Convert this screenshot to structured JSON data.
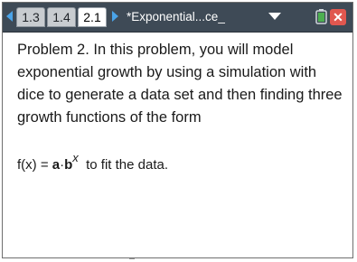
{
  "tabs": [
    {
      "label": "1.3",
      "active": false
    },
    {
      "label": "1.4",
      "active": false
    },
    {
      "label": "2.1",
      "active": true
    }
  ],
  "document_title": "*Exponential...ce_",
  "close_label": "✕",
  "problem_text": "Problem 2. In this problem, you will model exponential growth by using a simulation with dice to generate a data set and then finding three growth  functions of the form",
  "formula": {
    "prefix": "f(x) = ",
    "a": "a",
    "dot": "·",
    "b": "b",
    "exponent": "x",
    "suffix": "  to fit the data."
  },
  "colors": {
    "topbar": "#3e4a56",
    "arrow": "#4aa3e8",
    "close": "#e0574f",
    "battery": "#4caf50"
  }
}
